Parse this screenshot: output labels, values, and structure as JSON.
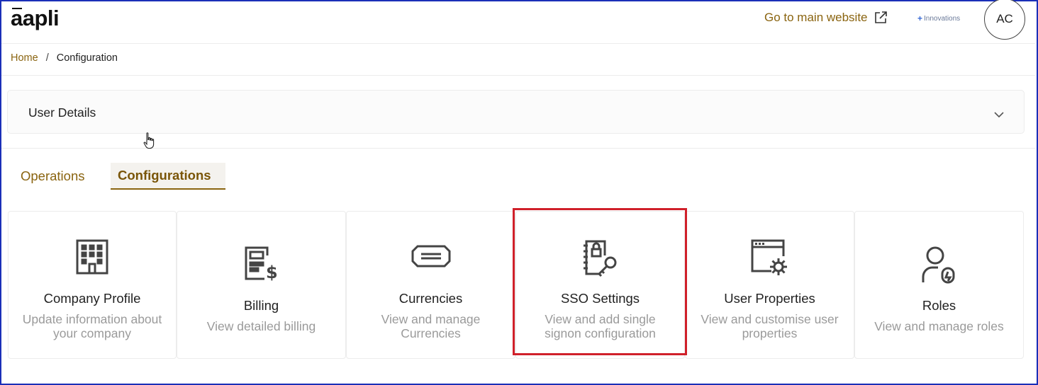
{
  "brand": {
    "logo_text": "aapli"
  },
  "header": {
    "main_website_label": "Go to main website",
    "innovations_label": "Innovations",
    "avatar_initials": "AC"
  },
  "breadcrumb": {
    "home": "Home",
    "separator": "/",
    "current": "Configuration"
  },
  "user_details": {
    "title": "User Details"
  },
  "tabs": [
    {
      "label": "Operations",
      "active": false
    },
    {
      "label": "Configurations",
      "active": true
    }
  ],
  "cards": [
    {
      "title": "Company Profile",
      "desc_line1": "Update information about",
      "desc_line2": "your company",
      "icon": "building-icon"
    },
    {
      "title": "Billing",
      "desc_line1": "View detailed billing",
      "desc_line2": "",
      "icon": "billing-icon"
    },
    {
      "title": "Currencies",
      "desc_line1": "View and manage",
      "desc_line2": "Currencies",
      "icon": "currency-note-icon"
    },
    {
      "title": "SSO Settings",
      "desc_line1": "View and add single",
      "desc_line2": "signon configuration",
      "icon": "sso-key-icon"
    },
    {
      "title": "User Properties",
      "desc_line1": "View and customise user",
      "desc_line2": "properties",
      "icon": "window-gear-icon"
    },
    {
      "title": "Roles",
      "desc_line1": "View and manage roles",
      "desc_line2": "",
      "icon": "user-role-icon"
    }
  ],
  "colors": {
    "accent": "#8a6410",
    "highlight_box": "#d0202a",
    "muted_text": "#9a9a9a",
    "frame": "#1a2fb8"
  }
}
